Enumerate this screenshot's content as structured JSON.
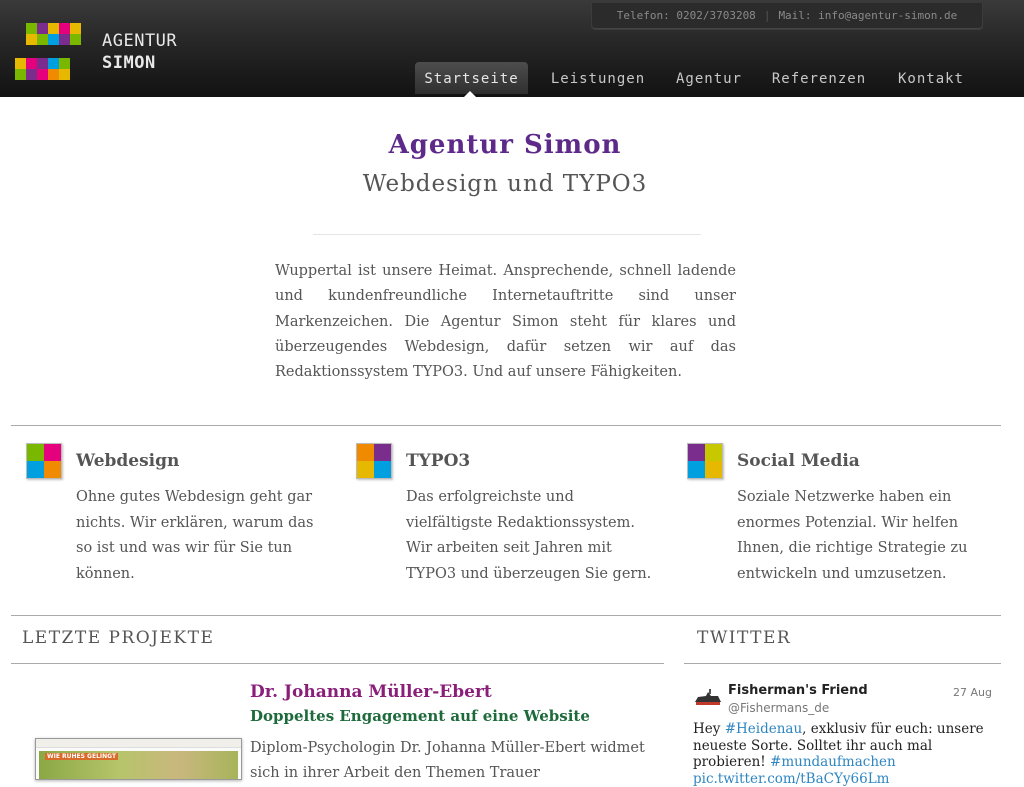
{
  "brand": {
    "line1": "AGENTUR",
    "line2": "SIMON",
    "logo_colors": [
      "#7b2d8e",
      "#e6b800",
      "#7ab800",
      "#e5007d",
      "#00a0e0",
      "#f08a00",
      "#c8c800"
    ]
  },
  "contact": {
    "phone": "Telefon: 0202/3703208",
    "separator": "|",
    "mail": "Mail: info@agentur-simon.de"
  },
  "nav": {
    "items": [
      "Startseite",
      "Leistungen",
      "Agentur",
      "Referenzen",
      "Kontakt"
    ],
    "active": "Startseite"
  },
  "hero": {
    "title": "Agentur Simon",
    "subtitle": "Webdesign und TYPO3",
    "intro": "Wuppertal ist unsere Heimat. Ansprechende, schnell ladende und kundenfreundliche Internetauftritte sind unser Markenzeichen. Die Agentur Simon steht für klares und überzeugendes Webdesign, dafür setzen wir auf das Redaktionssystem TYPO3. Und auf unsere Fähigkeiten."
  },
  "services": [
    {
      "title": "Webdesign",
      "text": "Ohne gutes Webdesign geht gar nichts. Wir erklären, warum das so ist und was wir für Sie tun können.",
      "icon": "webdesign-icon",
      "colors": [
        "#7ab800",
        "#e5007d",
        "#00a0e0",
        "#f08a00"
      ]
    },
    {
      "title": "TYPO3",
      "text": "Das erfolgreichste und vielfältigste Redaktionssystem. Wir arbeiten seit Jahren mit TYPO3 und überzeugen Sie gern.",
      "icon": "typo3-icon",
      "colors": [
        "#f08a00",
        "#7b2d8e",
        "#e6b800",
        "#00a0e0"
      ]
    },
    {
      "title": "Social Media",
      "text": "Soziale Netzwerke haben ein enormes Potenzial. Wir helfen Ihnen, die richtige Strategie zu entwickeln und umzusetzen.",
      "icon": "social-media-icon",
      "colors": [
        "#7b2d8e",
        "#c8c800",
        "#00a0e0",
        "#e6b800"
      ]
    }
  ],
  "projects": {
    "heading": "LETZTE PROJEKTE",
    "name": "Dr. Johanna Müller-Ebert",
    "subtitle": "Doppeltes Engagement auf eine Website",
    "text": "Diplom-Psychologin Dr. Johanna Müller-Ebert widmet sich in ihrer Arbeit den Themen Trauer",
    "thumb_banner": "WIE RUHES GELINGT"
  },
  "twitter": {
    "heading": "TWITTER",
    "user": "Fisherman's Friend",
    "handle": "@Fishermans_de",
    "date": "27 Aug",
    "text_plain": "Hey ",
    "hashtag1": "#Heidenau",
    "text_mid": ", exklusiv für euch: unsere neueste Sorte. Solltet ihr auch mal probieren! ",
    "hashtag2": "#mundaufmachen",
    "link": "pic.twitter.com/tBaCYy66Lm"
  }
}
